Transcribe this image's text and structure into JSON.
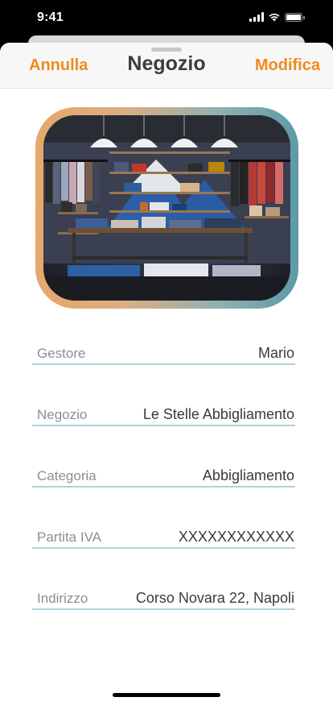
{
  "status_bar": {
    "time": "9:41",
    "signal_icon": "cellular-signal-icon",
    "wifi_icon": "wifi-icon",
    "battery_icon": "battery-icon"
  },
  "nav": {
    "cancel_label": "Annulla",
    "title": "Negozio",
    "edit_label": "Modifica"
  },
  "accent_color": "#f08b1d",
  "photo": {
    "icon": "store-photo"
  },
  "fields": [
    {
      "label": "Gestore",
      "value": "Mario"
    },
    {
      "label": "Negozio",
      "value": "Le Stelle Abbigliamento"
    },
    {
      "label": "Categoria",
      "value": "Abbigliamento"
    },
    {
      "label": "Partita IVA",
      "value": "XXXXXXXXXXXX"
    },
    {
      "label": "Indirizzo",
      "value": "Corso Novara 22, Napoli"
    }
  ]
}
